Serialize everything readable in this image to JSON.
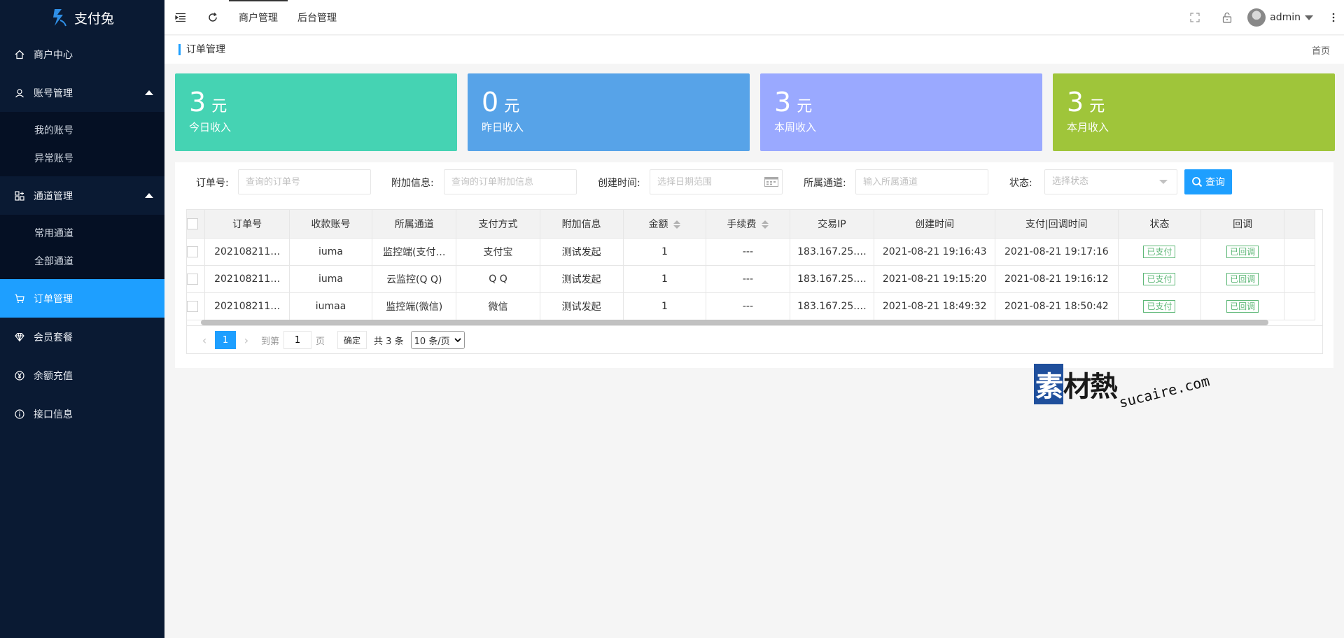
{
  "app": {
    "name": "支付兔"
  },
  "sidebar": {
    "items": [
      {
        "label": "商户中心"
      },
      {
        "label": "账号管理",
        "children": [
          {
            "label": "我的账号"
          },
          {
            "label": "异常账号"
          }
        ]
      },
      {
        "label": "通道管理",
        "children": [
          {
            "label": "常用通道"
          },
          {
            "label": "全部通道"
          }
        ]
      },
      {
        "label": "订单管理",
        "active": true
      },
      {
        "label": "会员套餐"
      },
      {
        "label": "余额充值"
      },
      {
        "label": "接口信息"
      }
    ]
  },
  "header": {
    "tabs": [
      {
        "label": "商户管理",
        "active": true
      },
      {
        "label": "后台管理"
      }
    ],
    "user": "admin"
  },
  "breadcrumb": {
    "current": "订单管理",
    "home": "首页"
  },
  "stats": [
    {
      "amount": "3",
      "unit": "元",
      "label": "今日收入",
      "color": "#45d3b3"
    },
    {
      "amount": "0",
      "unit": "元",
      "label": "昨日收入",
      "color": "#57a3e8"
    },
    {
      "amount": "3",
      "unit": "元",
      "label": "本周收入",
      "color": "#9aa9ff"
    },
    {
      "amount": "3",
      "unit": "元",
      "label": "本月收入",
      "color": "#9fc53a"
    }
  ],
  "filters": {
    "order_no": {
      "label": "订单号:",
      "placeholder": "查询的订单号"
    },
    "extra": {
      "label": "附加信息:",
      "placeholder": "查询的订单附加信息"
    },
    "created": {
      "label": "创建时间:",
      "placeholder": "选择日期范围"
    },
    "channel": {
      "label": "所属通道:",
      "placeholder": "输入所属通道"
    },
    "status": {
      "label": "状态:",
      "placeholder": "选择状态"
    },
    "search_label": "查询"
  },
  "table": {
    "columns": [
      "订单号",
      "收款账号",
      "所属通道",
      "支付方式",
      "附加信息",
      "金额",
      "手续费",
      "交易IP",
      "创建时间",
      "支付|回调时间",
      "状态",
      "回调"
    ],
    "rows": [
      {
        "order_no": "202108211…",
        "account": "iuma",
        "channel": "监控端(支付…",
        "method": "支付宝",
        "extra": "测试发起",
        "amount": "1",
        "fee": "---",
        "ip": "183.167.25.…",
        "created": "2021-08-21 19:16:43",
        "paid": "2021-08-21 19:17:16",
        "status": "已支付",
        "callback": "已回调"
      },
      {
        "order_no": "202108211…",
        "account": "iuma",
        "channel": "云监控(Q Q)",
        "method": "Q Q",
        "extra": "测试发起",
        "amount": "1",
        "fee": "---",
        "ip": "183.167.25.…",
        "created": "2021-08-21 19:15:20",
        "paid": "2021-08-21 19:16:12",
        "status": "已支付",
        "callback": "已回调"
      },
      {
        "order_no": "202108211…",
        "account": "iumaa",
        "channel": "监控端(微信)",
        "method": "微信",
        "extra": "测试发起",
        "amount": "1",
        "fee": "---",
        "ip": "183.167.25.…",
        "created": "2021-08-21 18:49:32",
        "paid": "2021-08-21 18:50:42",
        "status": "已支付",
        "callback": "已回调"
      }
    ]
  },
  "pager": {
    "current": "1",
    "goto_label": "到第",
    "goto_value": "1",
    "page_label": "页",
    "confirm": "确定",
    "total": "共 3 条",
    "page_size": "10 条/页"
  },
  "watermark": {
    "chinese_first": "素",
    "chinese_rest": "材熱",
    "latin": "sucaire.com"
  },
  "colors": {
    "sidebar_bg": "#0a1a33",
    "accent": "#1e9fff",
    "tag_green": "#5fb878"
  }
}
